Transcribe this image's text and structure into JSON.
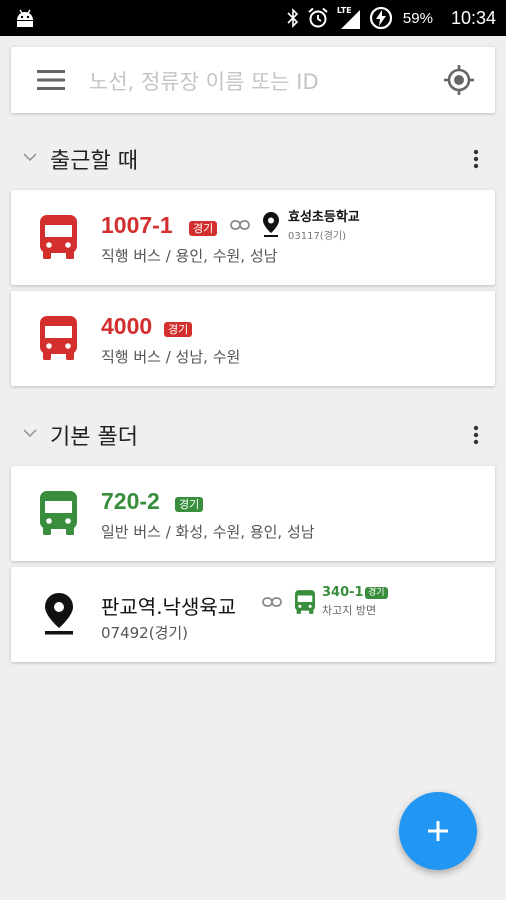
{
  "status_bar": {
    "network": "LTE",
    "battery_percent": "59%",
    "time": "10:34",
    "icons": [
      "android-icon",
      "bluetooth-icon",
      "alarm-icon",
      "signal-icon",
      "battery-charging-icon"
    ]
  },
  "search": {
    "placeholder": "노선, 정류장 이름 또는 ID"
  },
  "folders": [
    {
      "title": "출근할 때",
      "items": [
        {
          "route": "1007-1",
          "region": "경기",
          "description": "직행 버스 / 용인, 수원, 성남",
          "color": "#d32f2f",
          "linked_stop": {
            "name": "효성초등학교",
            "sub": "03117(경기)"
          }
        },
        {
          "route": "4000",
          "region": "경기",
          "description": "직행 버스 / 성남, 수원",
          "color": "#d32f2f"
        }
      ]
    },
    {
      "title": "기본 폴더",
      "items": [
        {
          "route": "720-2",
          "region": "경기",
          "description": "일반 버스 / 화성, 수원, 용인, 성남",
          "color": "#388e3c"
        },
        {
          "stop": "판교역.낙생육교",
          "stop_id": "07492(경기)",
          "linked_route": {
            "route": "340-1",
            "region": "경기",
            "direction": "차고지 방면",
            "color": "#388e3c"
          }
        }
      ]
    }
  ],
  "colors": {
    "express_bus": "#d32f2f",
    "regular_bus": "#388e3c",
    "fab": "#2196f3"
  }
}
